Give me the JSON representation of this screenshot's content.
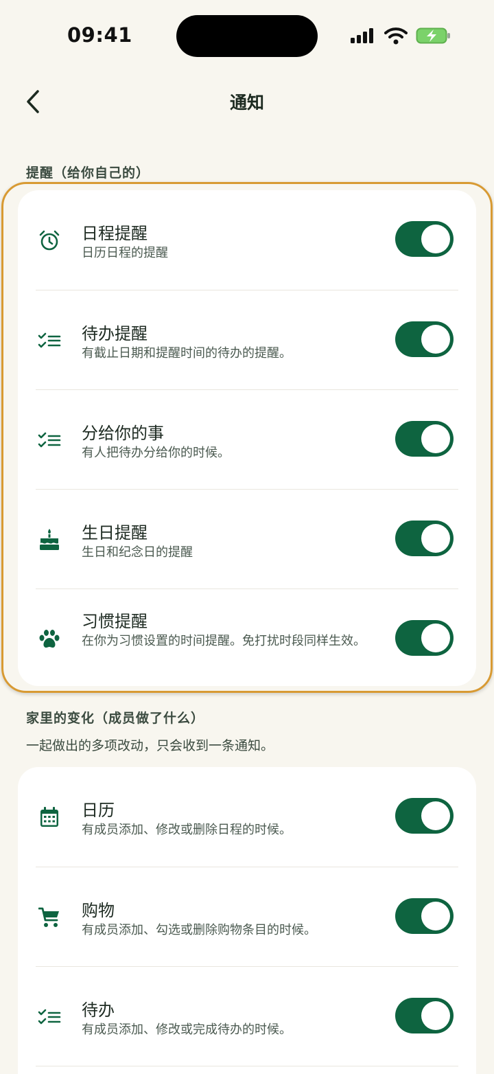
{
  "status_bar": {
    "time": "09:41"
  },
  "nav": {
    "title": "通知"
  },
  "sections": {
    "personal": {
      "title": "提醒（给你自己的）",
      "items": [
        {
          "label": "日程提醒",
          "sub": "日历日程的提醒",
          "icon": "alarm-clock-icon",
          "on": true
        },
        {
          "label": "待办提醒",
          "sub": "有截止日期和提醒时间的待办的提醒。",
          "icon": "checklist-icon",
          "on": true
        },
        {
          "label": "分给你的事",
          "sub": "有人把待办分给你的时候。",
          "icon": "checklist-icon",
          "on": true
        },
        {
          "label": "生日提醒",
          "sub": "生日和纪念日的提醒",
          "icon": "cake-icon",
          "on": true
        },
        {
          "label": "习惯提醒",
          "sub": "在你为习惯设置的时间提醒。免打扰时段同样生效。",
          "icon": "paw-icon",
          "on": true
        }
      ]
    },
    "family": {
      "title": "家里的变化（成员做了什么）",
      "description": "一起做出的多项改动，只会收到一条通知。",
      "items": [
        {
          "label": "日历",
          "sub": "有成员添加、修改或删除日程的时候。",
          "icon": "calendar-icon",
          "on": true
        },
        {
          "label": "购物",
          "sub": "有成员添加、勾选或删除购物条目的时候。",
          "icon": "cart-icon",
          "on": true
        },
        {
          "label": "待办",
          "sub": "有成员添加、修改或完成待办的时候。",
          "icon": "checklist-icon",
          "on": true
        }
      ]
    }
  },
  "colors": {
    "accent": "#0e6440",
    "highlight": "#d89a33",
    "background": "#f8f6ef"
  }
}
